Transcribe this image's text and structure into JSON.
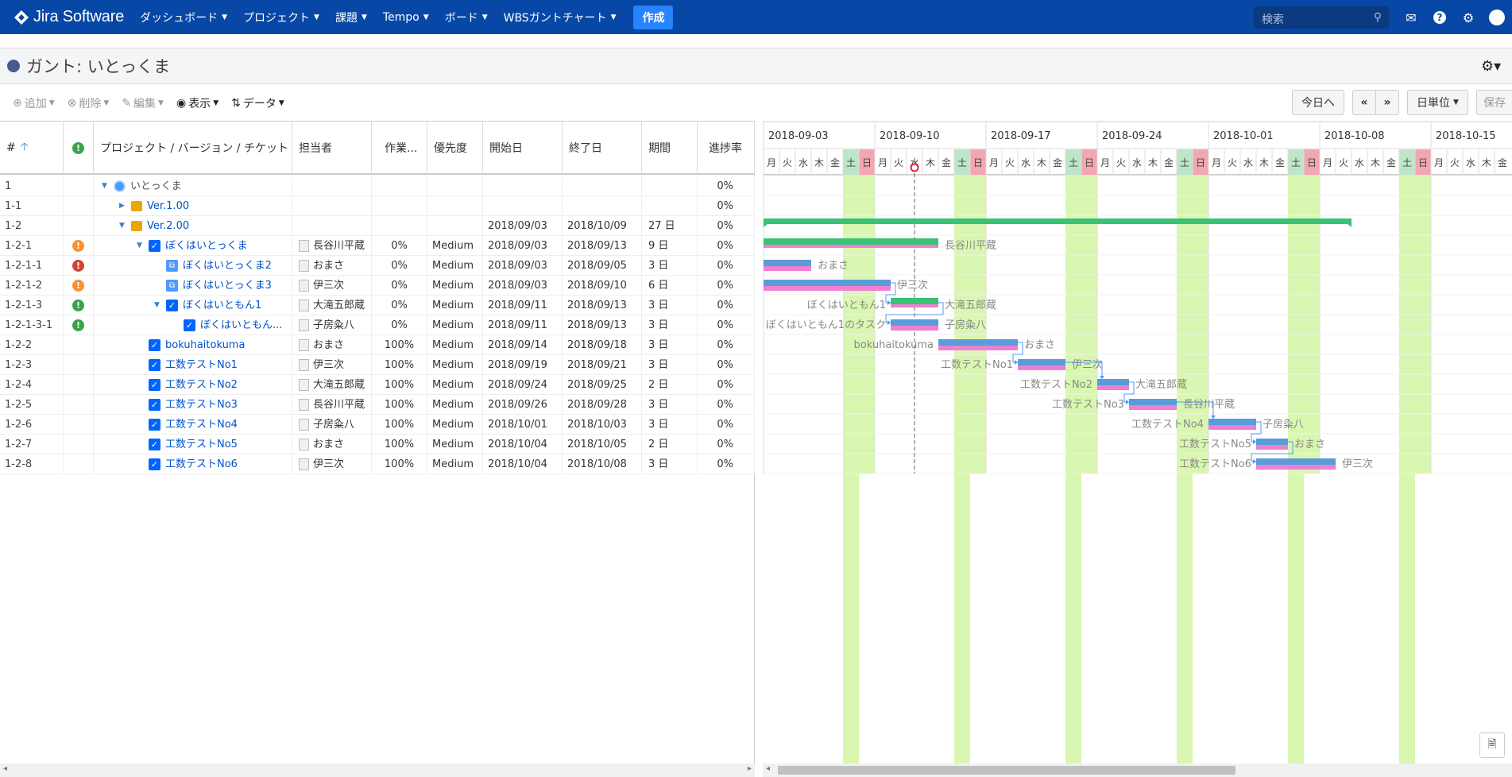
{
  "topnav": {
    "logo": "Jira Software",
    "items": [
      "ダッシュボード",
      "プロジェクト",
      "課題",
      "Tempo",
      "ボード",
      "WBSガントチャート"
    ],
    "create_label": "作成",
    "search_placeholder": "検索"
  },
  "page": {
    "title": "ガント: いとっくま"
  },
  "toolbar": {
    "add": "追加",
    "delete": "削除",
    "edit": "編集",
    "view": "表示",
    "data": "データ",
    "today": "今日へ",
    "prev": "«",
    "next": "»",
    "unit": "日単位",
    "save": "保存"
  },
  "grid": {
    "headers": {
      "num": "#",
      "title": "プロジェクト / バージョン / チケット",
      "assignee": "担当者",
      "work": "作業...",
      "priority": "優先度",
      "start": "開始日",
      "end": "終了日",
      "duration": "期間",
      "progress": "進捗率"
    },
    "rows": [
      {
        "id": "1",
        "level": 0,
        "kind": "project",
        "expander": "open",
        "title": "いとっくま",
        "priority_icon": "",
        "assignee": "",
        "work": "",
        "priority": "",
        "start": "",
        "end": "",
        "duration": "",
        "progress": "0%"
      },
      {
        "id": "1-1",
        "level": 1,
        "kind": "version",
        "expander": "closed",
        "title": "Ver.1.00",
        "priority_icon": "",
        "assignee": "",
        "work": "",
        "priority": "",
        "start": "",
        "end": "",
        "duration": "",
        "progress": "0%"
      },
      {
        "id": "1-2",
        "level": 1,
        "kind": "version",
        "expander": "open",
        "title": "Ver.2.00",
        "priority_icon": "",
        "assignee": "",
        "work": "",
        "priority": "",
        "start": "2018/09/03",
        "end": "2018/10/09",
        "duration": "27 日",
        "progress": "0%"
      },
      {
        "id": "1-2-1",
        "level": 2,
        "kind": "task",
        "expander": "open",
        "title": "ぼくはいとっくま",
        "priority_icon": "orange",
        "assignee": "長谷川平蔵",
        "work": "0%",
        "priority": "Medium",
        "start": "2018/09/03",
        "end": "2018/09/13",
        "duration": "9 日",
        "progress": "0%"
      },
      {
        "id": "1-2-1-1",
        "level": 3,
        "kind": "subtask",
        "expander": "",
        "title": "ぼくはいとっくま2",
        "priority_icon": "red",
        "assignee": "おまさ",
        "work": "0%",
        "priority": "Medium",
        "start": "2018/09/03",
        "end": "2018/09/05",
        "duration": "3 日",
        "progress": "0%"
      },
      {
        "id": "1-2-1-2",
        "level": 3,
        "kind": "subtask",
        "expander": "",
        "title": "ぼくはいとっくま3",
        "priority_icon": "orange",
        "assignee": "伊三次",
        "work": "0%",
        "priority": "Medium",
        "start": "2018/09/03",
        "end": "2018/09/10",
        "duration": "6 日",
        "progress": "0%"
      },
      {
        "id": "1-2-1-3",
        "level": 3,
        "kind": "task",
        "expander": "open",
        "title": "ぼくはいともん1",
        "priority_icon": "green",
        "assignee": "大滝五郎蔵",
        "work": "0%",
        "priority": "Medium",
        "start": "2018/09/11",
        "end": "2018/09/13",
        "duration": "3 日",
        "progress": "0%"
      },
      {
        "id": "1-2-1-3-1",
        "level": 4,
        "kind": "task",
        "expander": "",
        "title": "ぼくはいともん...",
        "priority_icon": "green",
        "assignee": "子房粂八",
        "work": "0%",
        "priority": "Medium",
        "start": "2018/09/11",
        "end": "2018/09/13",
        "duration": "3 日",
        "progress": "0%"
      },
      {
        "id": "1-2-2",
        "level": 2,
        "kind": "task",
        "expander": "",
        "title": "bokuhaitokuma",
        "priority_icon": "",
        "assignee": "おまさ",
        "work": "100%",
        "priority": "Medium",
        "start": "2018/09/14",
        "end": "2018/09/18",
        "duration": "3 日",
        "progress": "0%"
      },
      {
        "id": "1-2-3",
        "level": 2,
        "kind": "task",
        "expander": "",
        "title": "工数テストNo1",
        "priority_icon": "",
        "assignee": "伊三次",
        "work": "100%",
        "priority": "Medium",
        "start": "2018/09/19",
        "end": "2018/09/21",
        "duration": "3 日",
        "progress": "0%"
      },
      {
        "id": "1-2-4",
        "level": 2,
        "kind": "task",
        "expander": "",
        "title": "工数テストNo2",
        "priority_icon": "",
        "assignee": "大滝五郎蔵",
        "work": "100%",
        "priority": "Medium",
        "start": "2018/09/24",
        "end": "2018/09/25",
        "duration": "2 日",
        "progress": "0%"
      },
      {
        "id": "1-2-5",
        "level": 2,
        "kind": "task",
        "expander": "",
        "title": "工数テストNo3",
        "priority_icon": "",
        "assignee": "長谷川平蔵",
        "work": "100%",
        "priority": "Medium",
        "start": "2018/09/26",
        "end": "2018/09/28",
        "duration": "3 日",
        "progress": "0%"
      },
      {
        "id": "1-2-6",
        "level": 2,
        "kind": "task",
        "expander": "",
        "title": "工数テストNo4",
        "priority_icon": "",
        "assignee": "子房粂八",
        "work": "100%",
        "priority": "Medium",
        "start": "2018/10/01",
        "end": "2018/10/03",
        "duration": "3 日",
        "progress": "0%"
      },
      {
        "id": "1-2-7",
        "level": 2,
        "kind": "task",
        "expander": "",
        "title": "工数テストNo5",
        "priority_icon": "",
        "assignee": "おまさ",
        "work": "100%",
        "priority": "Medium",
        "start": "2018/10/04",
        "end": "2018/10/05",
        "duration": "2 日",
        "progress": "0%"
      },
      {
        "id": "1-2-8",
        "level": 2,
        "kind": "task",
        "expander": "",
        "title": "工数テストNo6",
        "priority_icon": "",
        "assignee": "伊三次",
        "work": "100%",
        "priority": "Medium",
        "start": "2018/10/04",
        "end": "2018/10/08",
        "duration": "3 日",
        "progress": "0%"
      }
    ]
  },
  "gantt": {
    "weeks": [
      "2018-09-03",
      "2018-09-10",
      "2018-09-17",
      "2018-09-24",
      "2018-10-01",
      "2018-10-08",
      "2018-10-15"
    ],
    "weekdays": [
      "月",
      "火",
      "水",
      "木",
      "金",
      "土",
      "日"
    ],
    "today_marker": "2018-09-12",
    "bars": [
      {
        "row": 2,
        "type": "summary",
        "start": "2018-09-03",
        "end": "2018-10-09",
        "label": "",
        "left_label": ""
      },
      {
        "row": 3,
        "type": "parent",
        "start": "2018-09-03",
        "end": "2018-09-13",
        "label": "長谷川平蔵",
        "left_label": ""
      },
      {
        "row": 4,
        "type": "task",
        "start": "2018-09-03",
        "end": "2018-09-05",
        "label": "おまさ",
        "left_label": ""
      },
      {
        "row": 5,
        "type": "task",
        "start": "2018-09-03",
        "end": "2018-09-10",
        "label": "伊三次",
        "left_label": ""
      },
      {
        "row": 6,
        "type": "parent",
        "start": "2018-09-11",
        "end": "2018-09-13",
        "label": "大滝五郎蔵",
        "left_label": "ぼくはいともん1"
      },
      {
        "row": 7,
        "type": "task",
        "start": "2018-09-11",
        "end": "2018-09-13",
        "label": "子房粂八",
        "left_label": "ぼくはいともん1のタスク"
      },
      {
        "row": 8,
        "type": "task",
        "start": "2018-09-14",
        "end": "2018-09-18",
        "label": "おまさ",
        "left_label": "bokuhaitokuma"
      },
      {
        "row": 9,
        "type": "task",
        "start": "2018-09-19",
        "end": "2018-09-21",
        "label": "伊三次",
        "left_label": "工数テストNo1"
      },
      {
        "row": 10,
        "type": "task",
        "start": "2018-09-24",
        "end": "2018-09-25",
        "label": "大滝五郎蔵",
        "left_label": "工数テストNo2"
      },
      {
        "row": 11,
        "type": "task",
        "start": "2018-09-26",
        "end": "2018-09-28",
        "label": "長谷川平蔵",
        "left_label": "工数テストNo3"
      },
      {
        "row": 12,
        "type": "task",
        "start": "2018-10-01",
        "end": "2018-10-03",
        "label": "子房粂八",
        "left_label": "工数テストNo4"
      },
      {
        "row": 13,
        "type": "task",
        "start": "2018-10-04",
        "end": "2018-10-05",
        "label": "おまさ",
        "left_label": "工数テストNo5"
      },
      {
        "row": 14,
        "type": "task",
        "start": "2018-10-04",
        "end": "2018-10-08",
        "label": "伊三次",
        "left_label": "工数テストNo6"
      }
    ],
    "links": [
      [
        5,
        6
      ],
      [
        6,
        7
      ],
      [
        8,
        9
      ],
      [
        9,
        10
      ],
      [
        10,
        11
      ],
      [
        11,
        12
      ],
      [
        12,
        13
      ],
      [
        13,
        14
      ]
    ]
  },
  "colors": {
    "nav": "#0747a6",
    "weekend_sat": "#d9f7b0",
    "weekend_sun": "#f4a6b0",
    "bar_top": "#5a9bd8",
    "bar_bottom": "#ef7fd3",
    "summary": "#3ac275",
    "today": "#e0243c"
  }
}
